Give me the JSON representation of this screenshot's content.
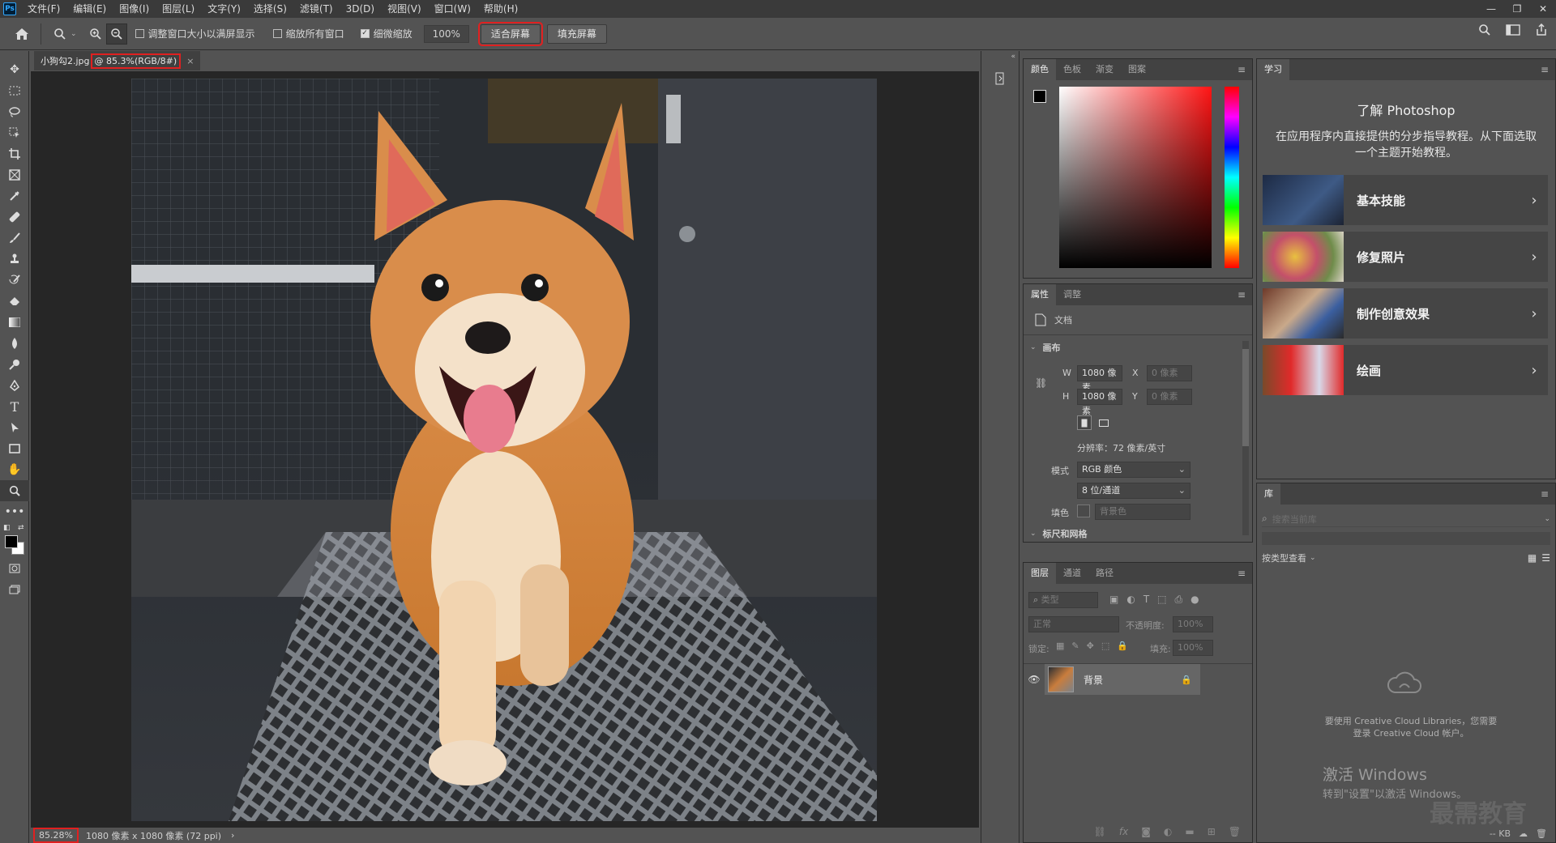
{
  "app": {
    "logo": "Ps",
    "menu": [
      "文件(F)",
      "编辑(E)",
      "图像(I)",
      "图层(L)",
      "文字(Y)",
      "选择(S)",
      "滤镜(T)",
      "3D(D)",
      "视图(V)",
      "窗口(W)",
      "帮助(H)"
    ],
    "window_controls": [
      "—",
      "❐",
      "✕"
    ]
  },
  "options_bar": {
    "resize_windows_label": "调整窗口大小以满屏显示",
    "zoom_all_label": "缩放所有窗口",
    "scrubby_zoom_label": "细微缩放",
    "scrubby_checked": true,
    "zoom_value": "100%",
    "fit_screen_label": "适合屏幕",
    "fill_screen_label": "填充屏幕"
  },
  "document": {
    "tab_name": "小狗勾2.jpg",
    "tab_zoom": "@ 85.3%(RGB/8#)",
    "tab_close": "×",
    "status_zoom": "85.28%",
    "status_info": "1080 像素 x 1080 像素 (72 ppi)",
    "status_arrow": "›"
  },
  "color_panel": {
    "tabs": [
      "颜色",
      "色板",
      "渐变",
      "图案"
    ],
    "active_tab": 0
  },
  "properties_panel": {
    "tabs": [
      "属性",
      "调整"
    ],
    "doc_label": "文档",
    "section_canvas": "画布",
    "w_label": "W",
    "w_value": "1080 像素",
    "h_label": "H",
    "h_value": "1080 像素",
    "x_label": "X",
    "x_value": "0 像素",
    "y_label": "Y",
    "y_value": "0 像素",
    "resolution": "分辨率：72 像素/英寸",
    "mode_label": "模式",
    "mode_value": "RGB 颜色",
    "depth_value": "8 位/通道",
    "fill_label": "填色",
    "fill_value": "背景色",
    "next_section": "标尺和网格"
  },
  "layers_panel": {
    "tabs": [
      "图层",
      "通道",
      "路径"
    ],
    "filter_placeholder": "类型",
    "blend_mode": "正常",
    "opacity_label": "不透明度:",
    "opacity_value": "100%",
    "lock_label": "锁定:",
    "fill_label": "填充:",
    "fill_value": "100%",
    "layers": [
      {
        "name": "背景",
        "visible": true,
        "locked": true
      }
    ]
  },
  "learn_panel": {
    "tab": "学习",
    "title": "了解 Photoshop",
    "description": "在应用程序内直接提供的分步指导教程。从下面选取一个主题开始教程。",
    "topics": [
      "基本技能",
      "修复照片",
      "制作创意效果",
      "绘画"
    ]
  },
  "library_panel": {
    "tab": "库",
    "search_placeholder": "搜索当前库",
    "view_by": "按类型查看",
    "message": "要使用 Creative Cloud Libraries，您需要登录 Creative Cloud 帐户。",
    "size": "-- KB"
  },
  "watermark": {
    "activate_title": "激活 Windows",
    "activate_sub": "转到\"设置\"以激活 Windows。",
    "brand": "最需教育"
  },
  "colors": {
    "highlight": "#e02020",
    "panel_bg": "#535353",
    "dark_bg": "#262626"
  }
}
